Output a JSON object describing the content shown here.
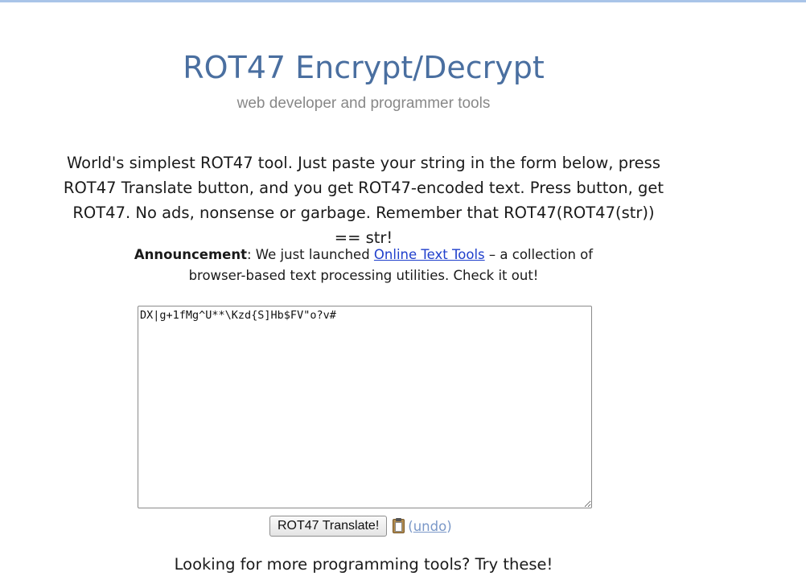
{
  "header": {
    "title": "ROT47 Encrypt/Decrypt",
    "subtitle": "web developer and programmer tools"
  },
  "intro": {
    "text": "World's simplest ROT47 tool. Just paste your string in the form below, press ROT47 Translate button, and you get ROT47-encoded text. Press button, get ROT47. No ads, nonsense or garbage. Remember that ROT47(ROT47(str)) == str!"
  },
  "announcement": {
    "label": "Announcement",
    "text_before": ": We just launched ",
    "link_text": "Online Text Tools",
    "text_after": " – a collection of browser-based text processing utilities. Check it out!"
  },
  "editor": {
    "value": "DX|g+1fMg^U**\\Kzd{S]Hb$FV\"o?v#"
  },
  "controls": {
    "translate_label": "ROT47 Translate!",
    "clipboard_icon": "clipboard-icon",
    "undo_open": "(",
    "undo_label": "undo",
    "undo_close": ")"
  },
  "footer": {
    "more_tools": "Looking for more programming tools? Try these!"
  },
  "colors": {
    "title": "#4a6fa0",
    "subtitle": "#888888",
    "link": "#1f3fcc",
    "undo_link": "#7a98c8",
    "top_border": "#a9c4e8"
  }
}
